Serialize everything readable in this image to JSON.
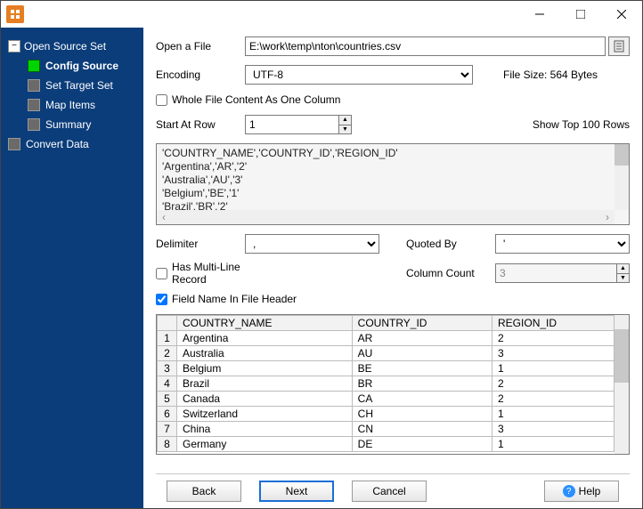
{
  "nav": {
    "open_source_set": "Open Source Set",
    "config_source": "Config Source",
    "set_target_set": "Set Target Set",
    "map_items": "Map Items",
    "summary": "Summary",
    "convert_data": "Convert Data"
  },
  "form": {
    "open_file_label": "Open a File",
    "file_path": "E:\\work\\temp\\nton\\countries.csv",
    "encoding_label": "Encoding",
    "encoding_value": "UTF-8",
    "file_size": "File Size: 564 Bytes",
    "whole_file_checkbox": "Whole File Content As One Column",
    "start_row_label": "Start At Row",
    "start_row_value": "1",
    "show_top_rows": "Show Top 100 Rows",
    "preview_lines": [
      "'COUNTRY_NAME','COUNTRY_ID','REGION_ID'",
      "'Argentina','AR','2'",
      "'Australia','AU','3'",
      "'Belgium','BE','1'",
      "'Brazil','BR','2'"
    ],
    "delimiter_label": "Delimiter",
    "delimiter_value": ",",
    "quoted_by_label": "Quoted By",
    "quoted_by_value": "'",
    "multi_line_checkbox": "Has Multi-Line Record",
    "column_count_label": "Column Count",
    "column_count_value": "3",
    "field_name_checkbox": "Field Name In File Header"
  },
  "table": {
    "headers": [
      "COUNTRY_NAME",
      "COUNTRY_ID",
      "REGION_ID"
    ],
    "rows": [
      {
        "n": "1",
        "c": [
          "Argentina",
          "AR",
          "2"
        ]
      },
      {
        "n": "2",
        "c": [
          "Australia",
          "AU",
          "3"
        ]
      },
      {
        "n": "3",
        "c": [
          "Belgium",
          "BE",
          "1"
        ]
      },
      {
        "n": "4",
        "c": [
          "Brazil",
          "BR",
          "2"
        ]
      },
      {
        "n": "5",
        "c": [
          "Canada",
          "CA",
          "2"
        ]
      },
      {
        "n": "6",
        "c": [
          "Switzerland",
          "CH",
          "1"
        ]
      },
      {
        "n": "7",
        "c": [
          "China",
          "CN",
          "3"
        ]
      },
      {
        "n": "8",
        "c": [
          "Germany",
          "DE",
          "1"
        ]
      }
    ]
  },
  "footer": {
    "back": "Back",
    "next": "Next",
    "cancel": "Cancel",
    "help": "Help"
  }
}
